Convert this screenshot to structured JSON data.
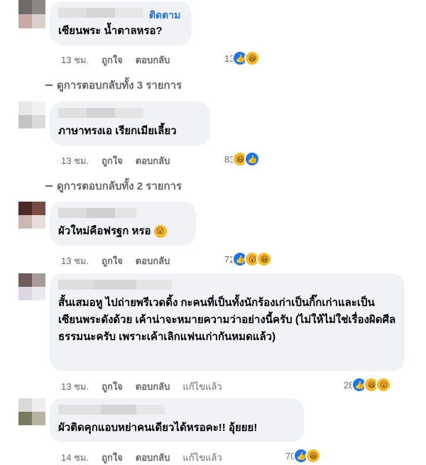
{
  "comments": [
    {
      "text": "เซียนพระ น้ำตาลหรอ?",
      "follow_label": "ติดตาม",
      "time": "13 ชม.",
      "like_label": "ถูกใจ",
      "reply_label": "ตอบกลับ",
      "reaction_count": "13",
      "reactions": [
        "like",
        "haha"
      ]
    },
    {
      "text": "ภาษาทรงเอ เรียกเมียเลี้ยว",
      "time": "13 ชม.",
      "like_label": "ถูกใจ",
      "reply_label": "ตอบกลับ",
      "reaction_count": "83",
      "reactions": [
        "haha",
        "like"
      ]
    },
    {
      "text": "ผัวใหม่คือฟรฐก หรอ",
      "text_emoji": "wow",
      "time": "13 ชม.",
      "like_label": "ถูกใจ",
      "reply_label": "ตอบกลับ",
      "reaction_count": "72",
      "reactions": [
        "like",
        "wow",
        "haha"
      ]
    },
    {
      "text": "สั้นเสมอหู ไปถ่ายพรีเวดดิ้ง กะคนที่เป็นทั้งนักร้องเก่าเป็นกิ๊กเก่าและเป็นเซียนพระดังด้วย เค้าน่าจะหมายความว่าอย่างนี้ครับ (ไม่ให้ไม่ใช่เรื่องผิดศีลธรรมนะครับ เพราะเค้าเลิกแฟนเก่ากันหมดแล้ว)",
      "time": "13 ชม.",
      "like_label": "ถูกใจ",
      "reply_label": "ตอบกลับ",
      "edited_label": "แก้ไขแล้ว",
      "reaction_count": "28",
      "reactions": [
        "like",
        "haha",
        "wow"
      ]
    },
    {
      "text": "ผัวติดคุกแอบหย่าคนเดียวได้หรอคะ!! อุ้ยยย!",
      "time": "14 ชม.",
      "like_label": "ถูกใจ",
      "reply_label": "ตอบกลับ",
      "edited_label": "แก้ไขแล้ว",
      "reaction_count": "70",
      "reactions": [
        "like",
        "haha"
      ]
    }
  ],
  "view_replies": [
    "ดูการตอบกลับทั้ง 3 รายการ",
    "ดูการตอบกลับทั้ง 2 รายการ"
  ],
  "colors": {
    "bubble": "#f0f2f5",
    "meta_text": "#65676b",
    "follow": "#216fdb",
    "like": "#1877f2",
    "emoji": "#f7b928"
  },
  "icons": {
    "like": "thumbs-up-icon",
    "haha": "haha-emoji-icon",
    "wow": "wow-emoji-icon"
  }
}
